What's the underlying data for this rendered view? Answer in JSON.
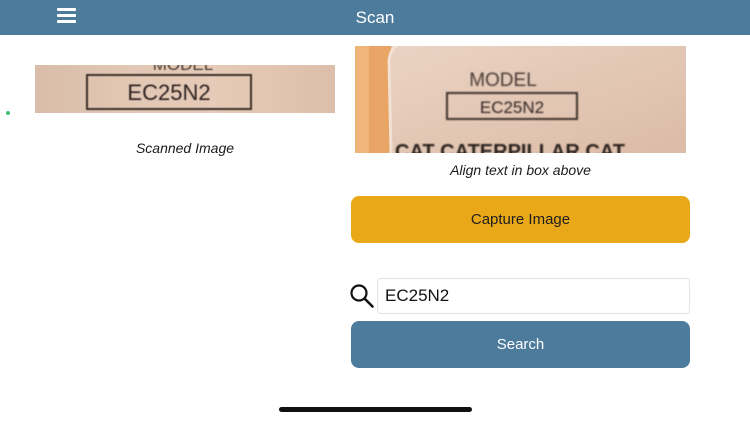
{
  "navbar": {
    "title": "Scan",
    "menu_icon": "hamburger-menu-icon",
    "background_color": "#4d7b9c"
  },
  "scanned": {
    "label_top_text": "MODEL",
    "label_text": "EC25N2",
    "caption": "Scanned Image"
  },
  "camera": {
    "model_label": "MODEL",
    "model_value": "EC25N2",
    "bottom_text": "CAT  CATERPILLAR  CAT",
    "caption": "Align text in box above"
  },
  "capture": {
    "label": "Capture Image",
    "color": "#e9a818"
  },
  "search": {
    "icon": "search-icon",
    "value": "EC25N2",
    "button_label": "Search",
    "button_color": "#4d7b9c"
  }
}
